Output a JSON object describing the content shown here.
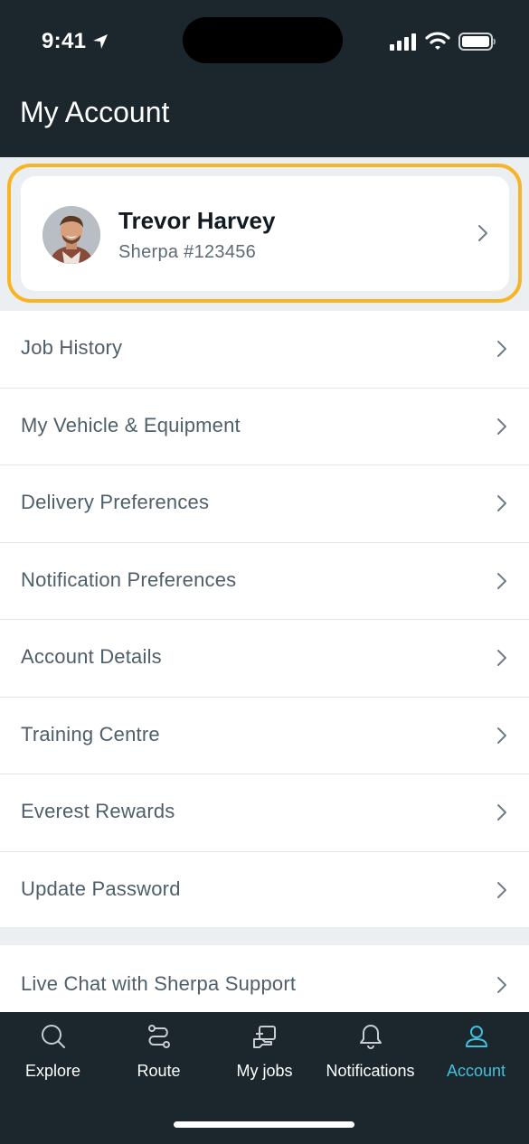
{
  "status_bar": {
    "time": "9:41"
  },
  "header": {
    "title": "My Account"
  },
  "profile": {
    "name": "Trevor Harvey",
    "id_text": "Sherpa #123456"
  },
  "menu": {
    "items": [
      {
        "label": "Job History"
      },
      {
        "label": "My Vehicle & Equipment"
      },
      {
        "label": "Delivery Preferences"
      },
      {
        "label": "Notification Preferences"
      },
      {
        "label": "Account Details"
      },
      {
        "label": "Training Centre"
      },
      {
        "label": "Everest Rewards"
      },
      {
        "label": "Update Password"
      }
    ],
    "support_label": "Live Chat with Sherpa Support"
  },
  "tabs": [
    {
      "label": "Explore",
      "icon": "search-icon"
    },
    {
      "label": "Route",
      "icon": "route-icon"
    },
    {
      "label": "My jobs",
      "icon": "jobs-icon"
    },
    {
      "label": "Notifications",
      "icon": "bell-icon"
    },
    {
      "label": "Account",
      "icon": "user-icon",
      "active": true
    }
  ],
  "colors": {
    "header_bg": "#1b272d",
    "highlight": "#f6b526",
    "active_tab": "#41c0dd",
    "menu_text": "#4e5f69"
  }
}
